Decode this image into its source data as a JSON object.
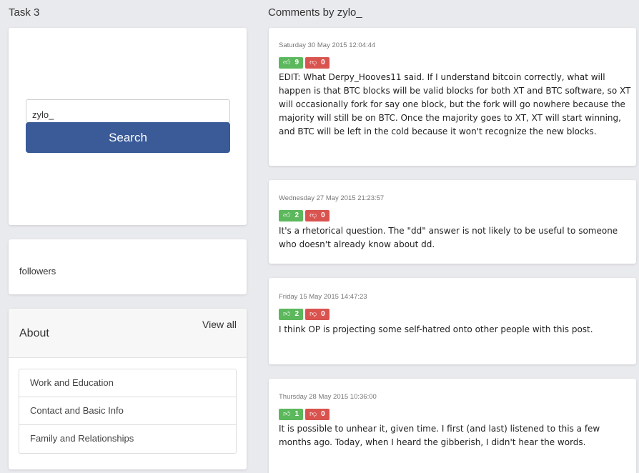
{
  "left_heading": "Task 3",
  "right_heading": "Comments by zylo_",
  "search": {
    "value": "zylo_",
    "button_label": "Search"
  },
  "followers": {
    "label": "followers"
  },
  "about": {
    "title": "About",
    "view_all": "View all",
    "items": [
      "Work and Education",
      "Contact and Basic Info",
      "Family and Relationships"
    ]
  },
  "comments": [
    {
      "date": "Saturday 30 May 2015 12:04:44",
      "up": "9",
      "down": "0",
      "text": "EDIT: What Derpy_Hooves11 said. If I understand bitcoin correctly, what will happen is that BTC blocks will be valid blocks for both XT and BTC software, so XT will occasionally fork for say one block, but the fork will go nowhere because the majority will still be on BTC. Once the majority goes to XT, XT will start winning, and BTC will be left in the cold because it won't recognize the new blocks."
    },
    {
      "date": "Wednesday 27 May 2015 21:23:57",
      "up": "2",
      "down": "0",
      "text": "It's a rhetorical question. The \"dd\" answer is not likely to be useful to someone who doesn't already know about dd."
    },
    {
      "date": "Friday 15 May 2015 14:47:23",
      "up": "2",
      "down": "0",
      "text": "I think OP is projecting some self-hatred onto other people with this post."
    },
    {
      "date": "Thursday 28 May 2015 10:36:00",
      "up": "1",
      "down": "0",
      "text": "It is possible to unhear it, given time. I first (and last) listened to this a few months ago. Today, when I heard the gibberish, I didn't hear the words."
    }
  ],
  "icons": {
    "upvote": "thumbs-up-icon",
    "downvote": "thumbs-down-icon"
  },
  "colors": {
    "upvote": "#5cb85c",
    "downvote": "#d9534f",
    "search_button": "#3a5a98"
  }
}
